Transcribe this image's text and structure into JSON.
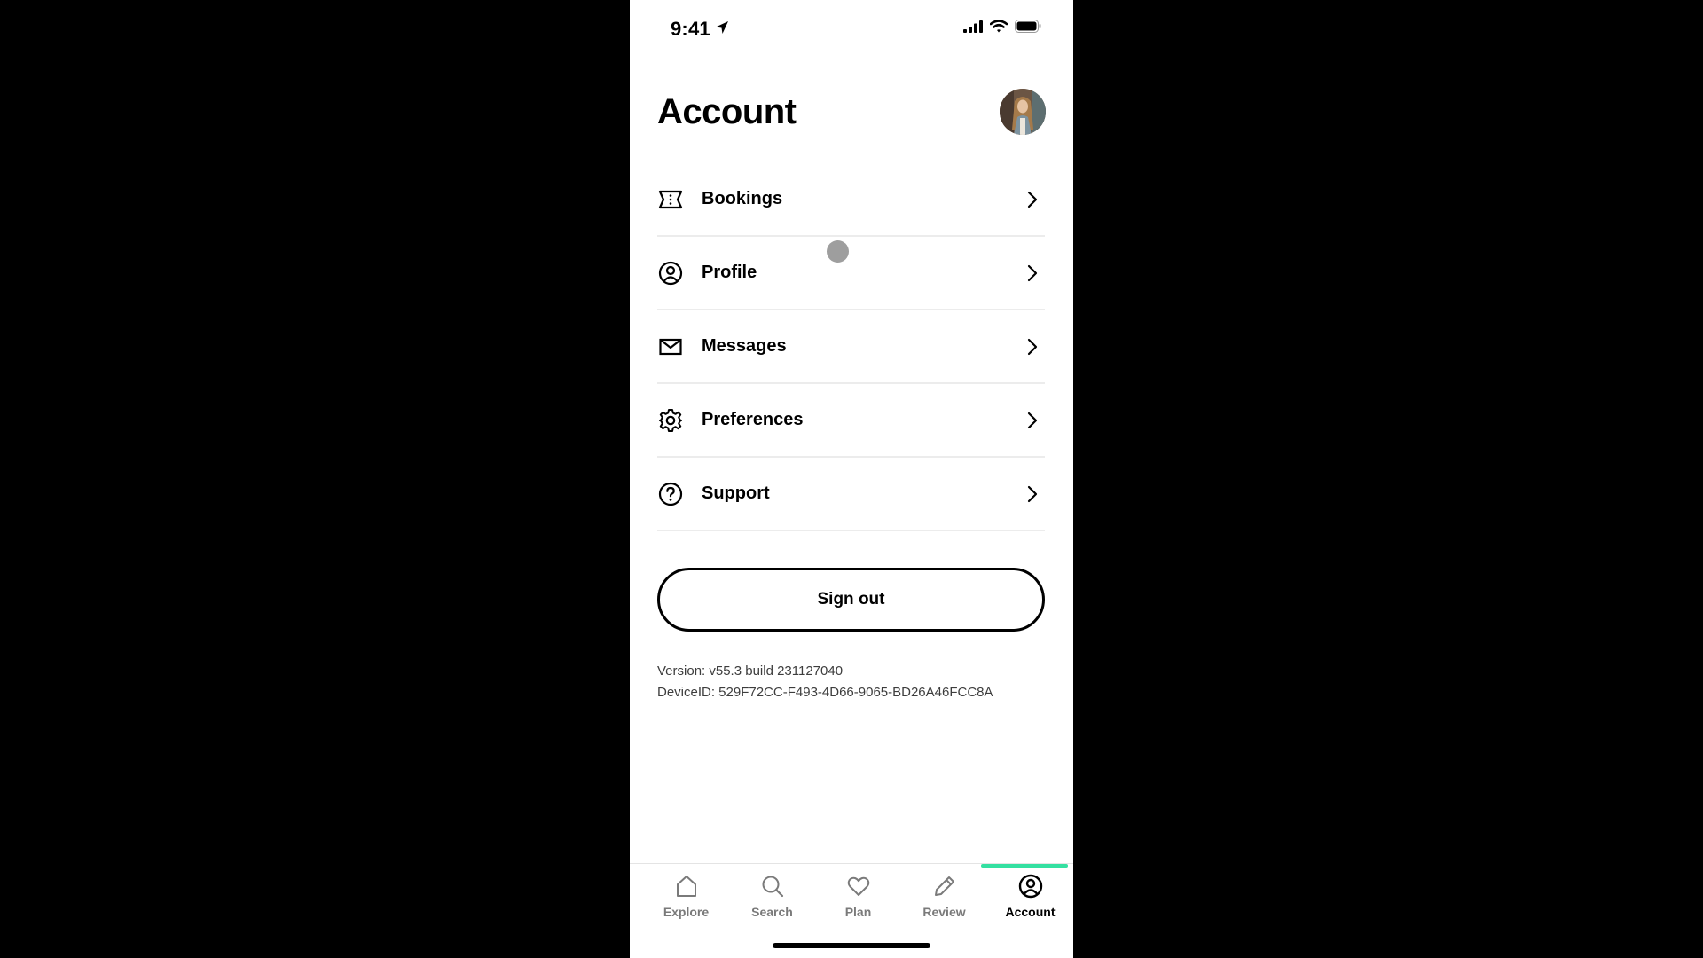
{
  "status_bar": {
    "time": "9:41",
    "location_icon": "location-arrow-icon",
    "signal_icon": "cellular-signal-icon",
    "wifi_icon": "wifi-icon",
    "battery_icon": "battery-full-icon"
  },
  "header": {
    "title": "Account",
    "avatar": "user-avatar-photo"
  },
  "menu": {
    "items": [
      {
        "label": "Bookings",
        "icon": "ticket-icon"
      },
      {
        "label": "Profile",
        "icon": "user-circle-icon"
      },
      {
        "label": "Messages",
        "icon": "envelope-icon"
      },
      {
        "label": "Preferences",
        "icon": "gear-icon"
      },
      {
        "label": "Support",
        "icon": "question-circle-icon"
      }
    ]
  },
  "signout": {
    "label": "Sign out"
  },
  "meta": {
    "version": "Version: v55.3 build 231127040",
    "device_id": "DeviceID: 529F72CC-F493-4D66-9065-BD26A46FCC8A"
  },
  "tabbar": {
    "active": "Account",
    "accent_color": "#34e0a1",
    "tabs": [
      {
        "label": "Explore",
        "icon": "home-icon"
      },
      {
        "label": "Search",
        "icon": "search-icon"
      },
      {
        "label": "Plan",
        "icon": "heart-icon"
      },
      {
        "label": "Review",
        "icon": "pencil-icon"
      },
      {
        "label": "Account",
        "icon": "user-circle-icon"
      }
    ]
  }
}
